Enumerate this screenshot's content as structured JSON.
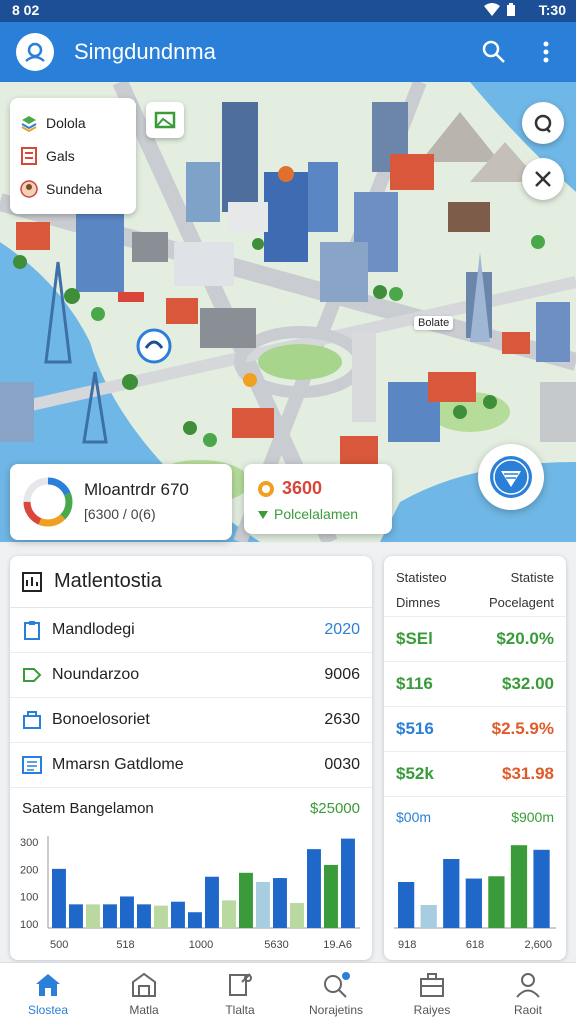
{
  "status_bar": {
    "time_left": "8 02",
    "time_right": "T:30"
  },
  "app_bar": {
    "title": "Simgdundnma",
    "actions": [
      "search-icon",
      "more-vert-icon"
    ]
  },
  "map": {
    "layers": [
      {
        "label": "Dolola",
        "icon": "stack-icon"
      },
      {
        "label": "Gals",
        "icon": "document-icon"
      },
      {
        "label": "Sundeha",
        "icon": "avatar-icon"
      }
    ],
    "labels": {
      "tag": "Bolate"
    }
  },
  "overlays": {
    "progress": {
      "title": "Mloantrdr 670",
      "subtitle": "[6300 / 0(6)",
      "fraction": 0.75,
      "colors": [
        "#2a80d8",
        "#4aa84a",
        "#f0a020",
        "#d9473a"
      ]
    },
    "money": {
      "value": "3600",
      "caption": "Polcelalamen"
    }
  },
  "main_panel": {
    "title": "Matlentostia",
    "rows": [
      {
        "icon": "clipboard-icon",
        "label": "Mandlodegi",
        "value": "2020",
        "color": "#2a80d8"
      },
      {
        "icon": "tag-icon",
        "label": "Noundarzoo",
        "value": "9006",
        "color": "#222222"
      },
      {
        "icon": "building-icon",
        "label": "Bonoelosoriet",
        "value": "2630",
        "color": "#222222"
      },
      {
        "icon": "list-icon",
        "label": "Mmarsn Gatdlome",
        "value": "0030",
        "color": "#222222"
      }
    ],
    "summary": {
      "label": "Satem Bangelamon",
      "value": "$25000",
      "color": "#3a9b3a"
    },
    "chart": {
      "y_ticks": [
        "300",
        "200",
        "100",
        "100"
      ],
      "x_ticks": [
        "500",
        "518",
        "1000",
        "5630",
        "19.A6"
      ],
      "bars": [
        {
          "value": 0.45,
          "color": "#1f68c9"
        },
        {
          "value": 0.18,
          "color": "#1f68c9"
        },
        {
          "value": 0.18,
          "color": "#b9d9a0"
        },
        {
          "value": 0.18,
          "color": "#1f68c9"
        },
        {
          "value": 0.24,
          "color": "#1f68c9"
        },
        {
          "value": 0.18,
          "color": "#1f68c9"
        },
        {
          "value": 0.17,
          "color": "#b9d9a0"
        },
        {
          "value": 0.2,
          "color": "#1f68c9"
        },
        {
          "value": 0.12,
          "color": "#1f68c9"
        },
        {
          "value": 0.39,
          "color": "#1f68c9"
        },
        {
          "value": 0.21,
          "color": "#b9d9a0"
        },
        {
          "value": 0.42,
          "color": "#3a9b3a"
        },
        {
          "value": 0.35,
          "color": "#a8cde0"
        },
        {
          "value": 0.38,
          "color": "#1f68c9"
        },
        {
          "value": 0.19,
          "color": "#b9d9a0"
        },
        {
          "value": 0.6,
          "color": "#1f68c9"
        },
        {
          "value": 0.48,
          "color": "#3a9b3a"
        },
        {
          "value": 0.68,
          "color": "#1f68c9"
        }
      ]
    }
  },
  "side_panel": {
    "col1_title": "Statisteo",
    "col2_title": "Statiste",
    "col1_sub": "Dimnes",
    "col2_sub": "Pocelagent",
    "rows": [
      {
        "left": "$SEl",
        "left_color": "#3a9b3a",
        "right": "$20.0%",
        "right_color": "#3a9b3a"
      },
      {
        "left": "$116",
        "left_color": "#3a9b3a",
        "right": "$32.00",
        "right_color": "#3a9b3a"
      },
      {
        "left": "$516",
        "left_color": "#2a80d8",
        "right": "$2.5.9%",
        "right_color": "#e05a2a"
      },
      {
        "left": "$52k",
        "left_color": "#3a9b3a",
        "right": "$31.98",
        "right_color": "#e05a2a"
      }
    ],
    "summary": {
      "left": "$00m",
      "right": "$900m",
      "color": "#2a80d8",
      "right_color": "#3a9b3a"
    },
    "chart": {
      "x_ticks": [
        "918",
        "618",
        "2,600"
      ],
      "bars": [
        {
          "value": 0.4,
          "color": "#1f68c9"
        },
        {
          "value": 0.2,
          "color": "#a8cde0"
        },
        {
          "value": 0.6,
          "color": "#1f68c9"
        },
        {
          "value": 0.43,
          "color": "#1f68c9"
        },
        {
          "value": 0.45,
          "color": "#3a9b3a"
        },
        {
          "value": 0.72,
          "color": "#3a9b3a"
        },
        {
          "value": 0.68,
          "color": "#1f68c9"
        }
      ]
    }
  },
  "bottom_nav": [
    {
      "label": "Slostea",
      "icon": "home-icon",
      "active": true
    },
    {
      "label": "Matla",
      "icon": "storefront-icon",
      "active": false
    },
    {
      "label": "Tlalta",
      "icon": "document-edit-icon",
      "active": false
    },
    {
      "label": "Norajetins",
      "icon": "search-badge-icon",
      "active": false
    },
    {
      "label": "Raiyes",
      "icon": "briefcase-icon",
      "active": false
    },
    {
      "label": "Raoit",
      "icon": "person-icon",
      "active": false
    }
  ]
}
